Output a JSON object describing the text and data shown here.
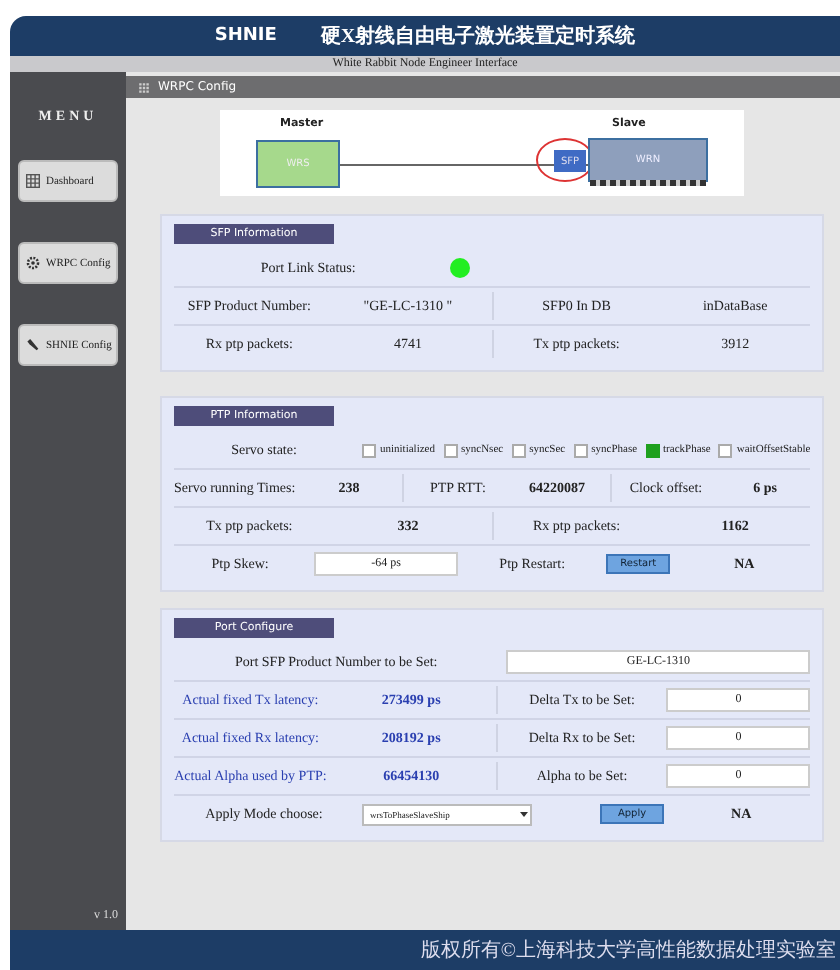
{
  "header": {
    "brand": "SHNIE",
    "title": "硬X射线自由电子激光装置定时系统",
    "subtitle": "White Rabbit Node Engineer Interface"
  },
  "sidebar": {
    "title": "MENU",
    "items": [
      {
        "label": "Dashboard",
        "kind": "dashboard"
      },
      {
        "label": "WRPC Config",
        "kind": "config"
      },
      {
        "label": "SHNIE Config",
        "kind": "tool"
      }
    ],
    "version": "v 1.0"
  },
  "page_title": "WRPC Config",
  "diagram": {
    "master_label": "Master",
    "slave_label": "Slave",
    "master_box": "WRS",
    "sfp_box": "SFP",
    "slave_box": "WRN"
  },
  "sfp": {
    "title": "SFP Information",
    "link_label": "Port Link Status:",
    "link_up": true,
    "rows": [
      {
        "label_1": "SFP Product Number:",
        "value_1": "\"GE-LC-1310        \"",
        "label_2": "SFP0 In DB",
        "value_2": "inDataBase"
      },
      {
        "label_1": "Rx ptp packets:",
        "value_1": "4741",
        "label_2": "Tx ptp packets:",
        "value_2": "3912"
      }
    ]
  },
  "ptp": {
    "title": "PTP Information",
    "servo_label": "Servo state:",
    "servo_states": [
      {
        "label": "uninitialized",
        "checked": false
      },
      {
        "label": "syncNsec",
        "checked": false
      },
      {
        "label": "syncSec",
        "checked": false
      },
      {
        "label": "syncPhase",
        "checked": false
      },
      {
        "label": "trackPhase",
        "checked": true
      },
      {
        "label": "waitOffsetStable",
        "checked": false
      }
    ],
    "stats": [
      {
        "label": "Servo running Times:",
        "value": "238"
      },
      {
        "label": "PTP RTT:",
        "value": "64220087"
      },
      {
        "label": "Clock offset:",
        "value": "6 ps"
      }
    ],
    "packets": [
      {
        "label": "Tx ptp packets:",
        "value": "332"
      },
      {
        "label": "Rx ptp packets:",
        "value": "1162"
      }
    ],
    "skew_label": "Ptp Skew:",
    "skew_value": "-64 ps",
    "restart_label": "Ptp Restart:",
    "restart_button": "Restart",
    "restart_status": "NA"
  },
  "port": {
    "title": "Port Configure",
    "sfp_label": "Port SFP Product Number to be Set:",
    "sfp_value": "GE-LC-1310",
    "rows": [
      {
        "label": "Actual fixed Tx latency:",
        "value": "273499 ps",
        "set_label": "Delta Tx to be Set:",
        "set_value": "0"
      },
      {
        "label": "Actual fixed Rx latency:",
        "value": "208192 ps",
        "set_label": "Delta Rx to be Set:",
        "set_value": "0"
      },
      {
        "label": "Actual Alpha used by PTP:",
        "value": "66454130",
        "set_label": "Alpha to be Set:",
        "set_value": "0"
      }
    ],
    "mode_label": "Apply Mode choose:",
    "mode_value": "wrsToPhaseSlaveShip",
    "apply_button": "Apply",
    "apply_status": "NA"
  },
  "footer": "版权所有©上海科技大学高性能数据处理实验室"
}
